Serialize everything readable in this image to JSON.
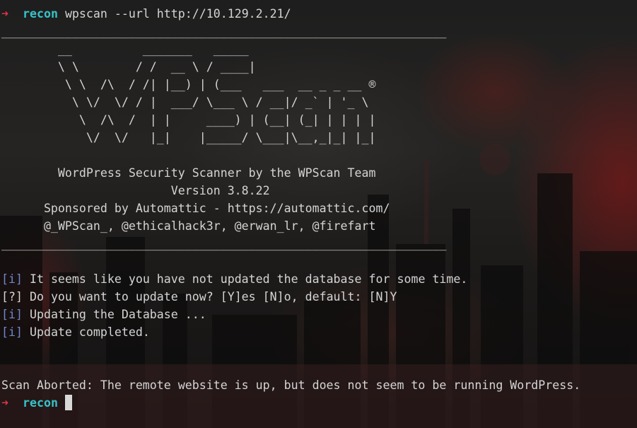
{
  "terminal": {
    "prompt_arrow": "➜",
    "prompt_dir": "recon",
    "command": "wpscan --url http://10.129.2.21/",
    "separator": "_______________________________________________________________",
    "banner": {
      "art_lines": [
        "        __          _______   _____",
        "        \\ \\        / /  __ \\ / ____|",
        "         \\ \\  /\\  / /| |__) | (___   ___  __ _ _ __ ®",
        "          \\ \\/  \\/ / |  ___/ \\___ \\ / __|/ _` | '_ \\",
        "           \\  /\\  /  | |     ____) | (__| (_| | | | |",
        "            \\/  \\/   |_|    |_____/ \\___|\\__,_|_| |_|"
      ],
      "title": "        WordPress Security Scanner by the WPScan Team",
      "version": "                        Version 3.8.22",
      "sponsor": "      Sponsored by Automattic - https://automattic.com/",
      "authors": "      @_WPScan_, @ethicalhack3r, @erwan_lr, @firefart"
    },
    "messages": [
      {
        "tag": "[i]",
        "text": " It seems like you have not updated the database for some time."
      },
      {
        "tag": "[?]",
        "text": " Do you want to update now? [Y]es [N]o, default: [N]Y"
      },
      {
        "tag": "[i]",
        "text": " Updating the Database ..."
      },
      {
        "tag": "[i]",
        "text": " Update completed."
      }
    ],
    "abort_message": "Scan Aborted: The remote website is up, but does not seem to be running WordPress.",
    "colors": {
      "arrow": "#e0344b",
      "prompt": "#37c2c9",
      "bracket": "#6f86c8",
      "text": "#d4d4d4"
    }
  }
}
